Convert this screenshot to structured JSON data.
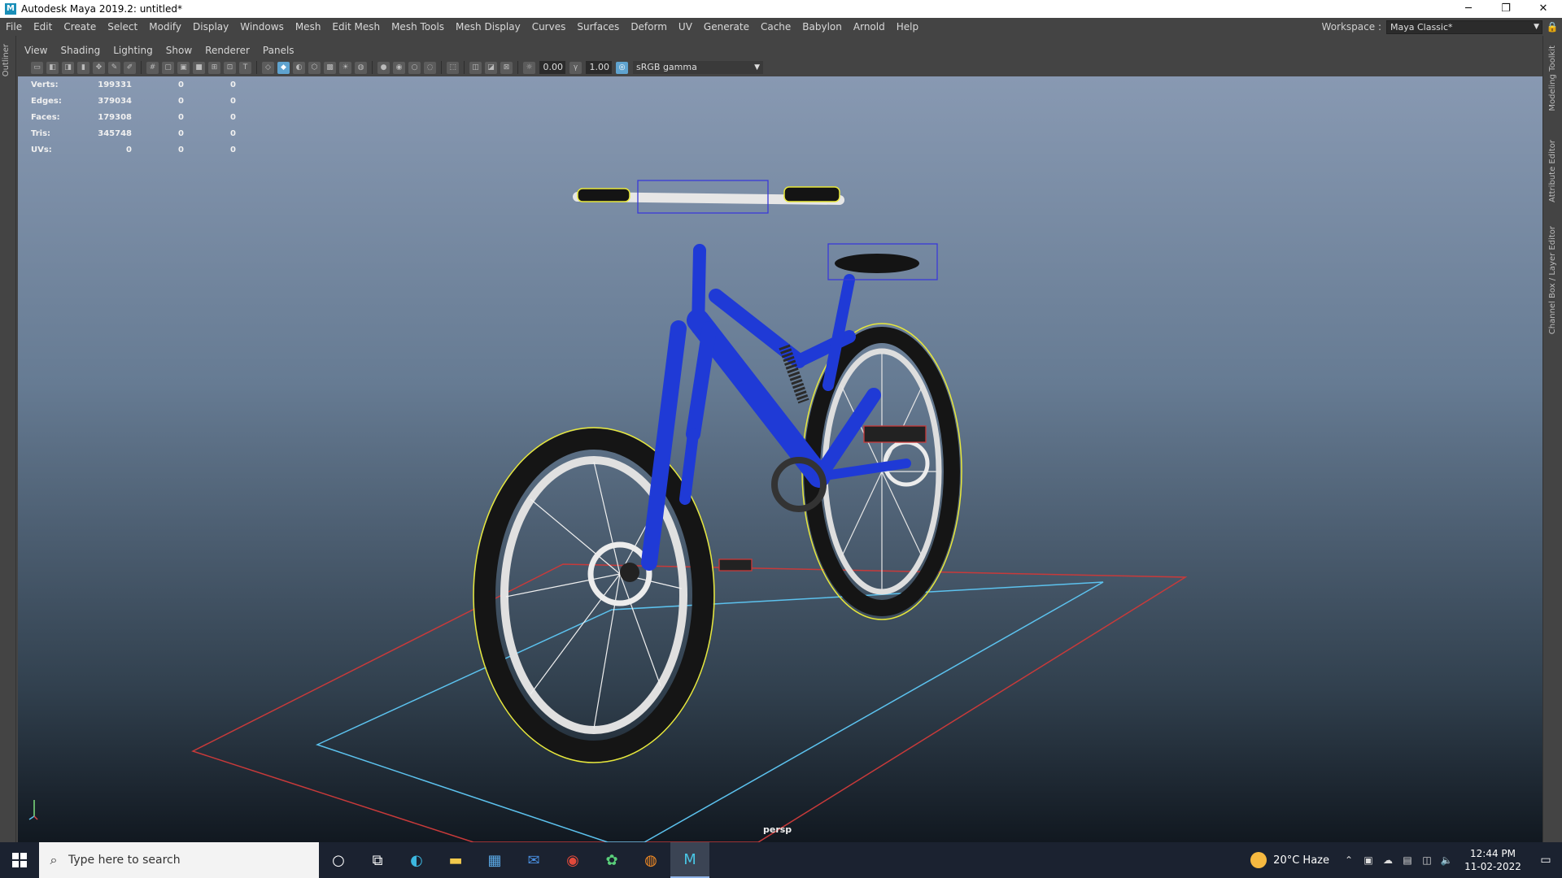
{
  "window": {
    "app_icon": "M",
    "title": "Autodesk Maya 2019.2: untitled*",
    "minimize": "─",
    "restore": "❐",
    "close": "✕"
  },
  "menubar": {
    "items": [
      "File",
      "Edit",
      "Create",
      "Select",
      "Modify",
      "Display",
      "Windows",
      "Mesh",
      "Edit Mesh",
      "Mesh Tools",
      "Mesh Display",
      "Curves",
      "Surfaces",
      "Deform",
      "UV",
      "Generate",
      "Cache",
      "Babylon",
      "Arnold",
      "Help"
    ],
    "workspace_label": "Workspace :",
    "workspace_value": "Maya Classic*"
  },
  "side_tabs": {
    "left": "Outliner",
    "right": [
      "Modeling Toolkit",
      "Attribute Editor",
      "Channel Box / Layer Editor"
    ]
  },
  "panel_menu": [
    "View",
    "Shading",
    "Lighting",
    "Show",
    "Renderer",
    "Panels"
  ],
  "toolbar": {
    "exposure": "0.00",
    "gamma": "1.00",
    "color_space": "sRGB gamma"
  },
  "hud": {
    "rows": [
      {
        "label": "Verts:",
        "v1": "199331",
        "v2": "0",
        "v3": "0"
      },
      {
        "label": "Edges:",
        "v1": "379034",
        "v2": "0",
        "v3": "0"
      },
      {
        "label": "Faces:",
        "v1": "179308",
        "v2": "0",
        "v3": "0"
      },
      {
        "label": "Tris:",
        "v1": "345748",
        "v2": "0",
        "v3": "0"
      },
      {
        "label": "UVs:",
        "v1": "0",
        "v2": "0",
        "v3": "0"
      }
    ]
  },
  "viewport": {
    "camera_label": "persp",
    "model_color": "#1f3ad6",
    "selection_color": "#e8e83a"
  },
  "taskbar": {
    "search_placeholder": "Type here to search",
    "weather": "20°C  Haze",
    "time": "12:44 PM",
    "date": "11-02-2022"
  }
}
